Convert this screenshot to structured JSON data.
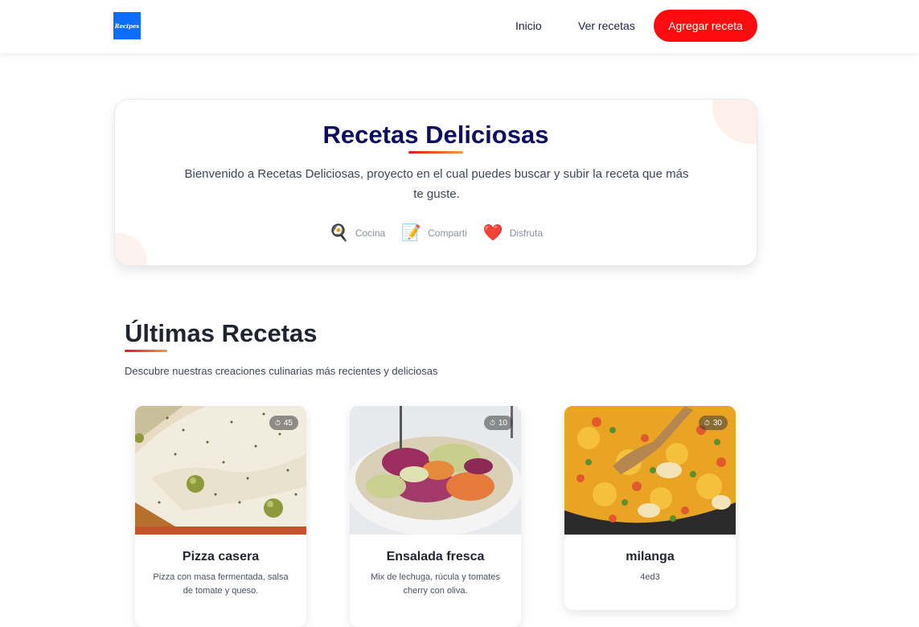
{
  "navbar": {
    "logo_text": "Recipes",
    "links": [
      {
        "label": "Inicio"
      },
      {
        "label": "Ver recetas"
      }
    ],
    "cta_label": "Agregar receta"
  },
  "hero": {
    "title": "Recetas Deliciosas",
    "description": "Bienvenido a Recetas Deliciosas, proyecto en el cual puedes buscar y subir la receta que más te guste.",
    "features": [
      {
        "icon": "frying-pan-icon",
        "label": "Cocina"
      },
      {
        "icon": "memo-icon",
        "label": "Comparti"
      },
      {
        "icon": "heart-icon",
        "label": "Disfruta"
      }
    ]
  },
  "section": {
    "title": "Últimas Recetas",
    "subtitle": "Descubre nuestras creaciones culinarias más recientes y deliciosas"
  },
  "recipes": [
    {
      "title": "Pizza casera",
      "description": "Pizza con masa fermentada, salsa de tomate y queso.",
      "time": "45"
    },
    {
      "title": "Ensalada fresca",
      "description": "Mix de lechuga, rúcula y tomates cherry con oliva.",
      "time": "10"
    },
    {
      "title": "milanga",
      "description": "4ed3",
      "time": "30"
    }
  ],
  "colors": {
    "accent": "#ff0a0e",
    "logo_bg": "#0d6efd",
    "title": "#0e0e5e"
  }
}
